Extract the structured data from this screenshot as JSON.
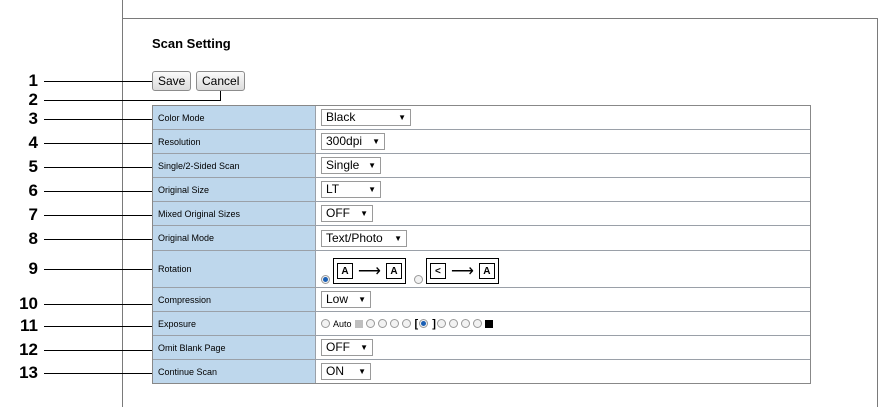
{
  "page": {
    "title": "Scan Setting"
  },
  "buttons": {
    "save": "Save",
    "cancel": "Cancel"
  },
  "callouts": [
    "1",
    "2",
    "3",
    "4",
    "5",
    "6",
    "7",
    "8",
    "9",
    "10",
    "11",
    "12",
    "13"
  ],
  "rows": {
    "color_mode": {
      "label": "Color Mode",
      "value": "Black"
    },
    "resolution": {
      "label": "Resolution",
      "value": "300dpi"
    },
    "sided": {
      "label": "Single/2-Sided Scan",
      "value": "Single"
    },
    "original_size": {
      "label": "Original Size",
      "value": "LT"
    },
    "mixed_sizes": {
      "label": "Mixed Original Sizes",
      "value": "OFF"
    },
    "original_mode": {
      "label": "Original Mode",
      "value": "Text/Photo"
    },
    "rotation": {
      "label": "Rotation",
      "selected_option": 1,
      "glyph": "A",
      "rotated_glyph": "<"
    },
    "compression": {
      "label": "Compression",
      "value": "Low"
    },
    "exposure": {
      "label": "Exposure",
      "auto_label": "Auto",
      "selected_level": 5,
      "levels": 9
    },
    "omit_blank": {
      "label": "Omit Blank Page",
      "value": "OFF"
    },
    "continue_scan": {
      "label": "Continue Scan",
      "value": "ON"
    }
  },
  "icons": {
    "dropdown": "chevron-down-icon",
    "rotate_arrow": "right-arrow-icon"
  },
  "colors": {
    "label_bg": "#bed7ec",
    "radio_selected": "#1a5fb4"
  }
}
